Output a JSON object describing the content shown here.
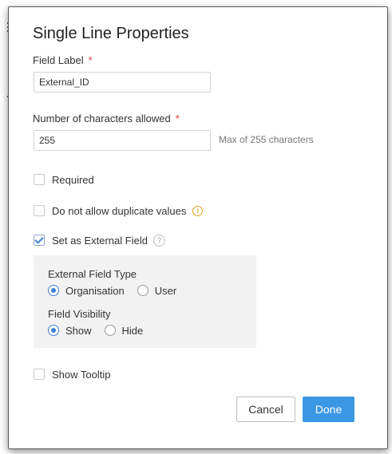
{
  "dialog": {
    "title": "Single Line Properties",
    "field_label": {
      "label": "Field Label",
      "required_mark": "*",
      "value": "External_ID"
    },
    "char_limit": {
      "label": "Number of characters allowed",
      "required_mark": "*",
      "value": "255",
      "hint": "Max of 255 characters"
    },
    "options": {
      "required": {
        "label": "Required",
        "checked": false
      },
      "no_duplicates": {
        "label": "Do not allow duplicate values",
        "checked": false,
        "icon": "info-icon",
        "icon_glyph": "i"
      },
      "external_field": {
        "label": "Set as External Field",
        "checked": true,
        "icon": "help-icon",
        "icon_glyph": "?"
      }
    },
    "external_panel": {
      "type_heading": "External Field Type",
      "type_options": [
        {
          "label": "Organisation",
          "selected": true
        },
        {
          "label": "User",
          "selected": false
        }
      ],
      "visibility_heading": "Field Visibility",
      "visibility_options": [
        {
          "label": "Show",
          "selected": true
        },
        {
          "label": "Hide",
          "selected": false
        }
      ]
    },
    "show_tooltip": {
      "label": "Show Tooltip",
      "checked": false
    },
    "buttons": {
      "cancel": "Cancel",
      "done": "Done"
    }
  },
  "colors": {
    "accent": "#3a97e4",
    "required_mark": "#e23b3b",
    "info_icon": "#e6a317",
    "panel_bg": "#f2f2f2"
  }
}
